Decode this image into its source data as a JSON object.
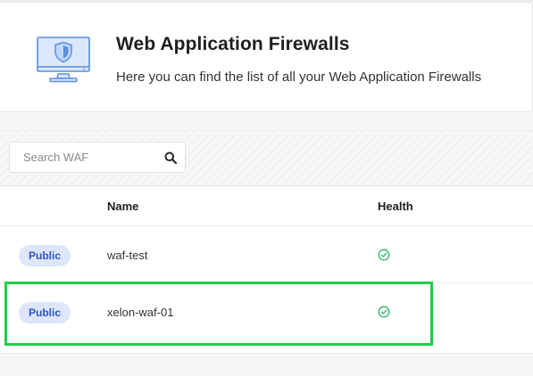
{
  "header": {
    "title": "Web Application Firewalls",
    "subtitle": "Here you can find the list of all your Web Application Firewalls",
    "icon": "monitor-shield-icon"
  },
  "search": {
    "placeholder": "Search WAF",
    "value": "",
    "icon": "search-icon"
  },
  "table": {
    "columns": {
      "type": "",
      "name": "Name",
      "health": "Health"
    },
    "rows": [
      {
        "visibility": "Public",
        "name": "waf-test",
        "health": "healthy"
      },
      {
        "visibility": "Public",
        "name": "xelon-waf-01",
        "health": "healthy"
      }
    ]
  },
  "colors": {
    "badge_bg": "#dde6fb",
    "badge_text": "#2f55c8",
    "health_ok": "#2fb36b",
    "highlight": "#1fcf48"
  }
}
